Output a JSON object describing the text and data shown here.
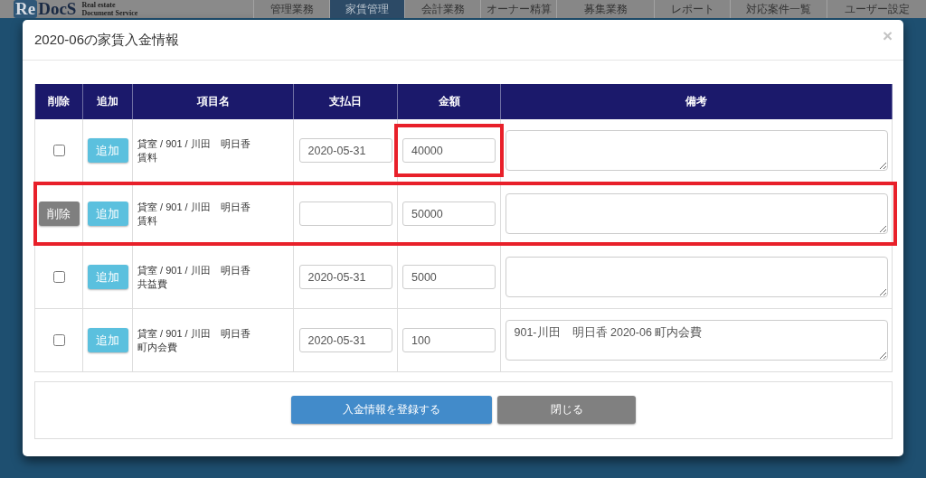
{
  "nav": {
    "logo": {
      "mark": "Re",
      "word": "DocS",
      "tagline": [
        "Real estate",
        "Document Service"
      ]
    },
    "tabs": [
      {
        "label": "管理業務",
        "selected": false
      },
      {
        "label": "家賃管理",
        "selected": true
      },
      {
        "label": "会計業務",
        "selected": false
      },
      {
        "label": "オーナー精算",
        "selected": false
      },
      {
        "label": "募集業務",
        "selected": false
      },
      {
        "label": "レポート",
        "selected": false
      },
      {
        "label": "対応案件一覧",
        "selected": false
      },
      {
        "label": "ユーザー設定",
        "selected": false
      }
    ]
  },
  "modal": {
    "title": "2020-06の家賃入金情報",
    "close": "×",
    "table": {
      "columns": [
        "削除",
        "追加",
        "項目名",
        "支払日",
        "金額",
        "備考"
      ],
      "rows": [
        {
          "delete": {
            "kind": "checkbox",
            "checked": false
          },
          "add_label": "追加",
          "item_path": "貸室 / 901 / 川田　明日香",
          "item_type": "賃料",
          "date": "2020-05-31",
          "amount": "40000",
          "row_highlighted": false,
          "amount_highlighted": true
        },
        {
          "delete": {
            "kind": "button",
            "label": "削除"
          },
          "add_label": "追加",
          "item_path": "貸室 / 901 / 川田　明日香",
          "item_type": "賃料",
          "amount": "50000",
          "row_highlighted": true,
          "amount_highlighted": false
        },
        {
          "delete": {
            "kind": "checkbox",
            "checked": false
          },
          "add_label": "追加",
          "item_path": "貸室 / 901 / 川田　明日香",
          "item_type": "共益費",
          "date": "2020-05-31",
          "amount": "5000",
          "row_highlighted": false,
          "amount_highlighted": false
        },
        {
          "delete": {
            "kind": "checkbox",
            "checked": false
          },
          "add_label": "追加",
          "item_path": "貸室 / 901 / 川田　明日香",
          "item_type": "町内会費",
          "date": "2020-05-31",
          "amount": "100",
          "remarks": "901-川田　明日香 2020-06 町内会費",
          "row_highlighted": false,
          "amount_highlighted": false
        }
      ]
    },
    "buttons": [
      {
        "label": "入金情報を登録する",
        "kind": "primary"
      },
      {
        "label": "閉じる",
        "kind": "secondary"
      }
    ]
  }
}
